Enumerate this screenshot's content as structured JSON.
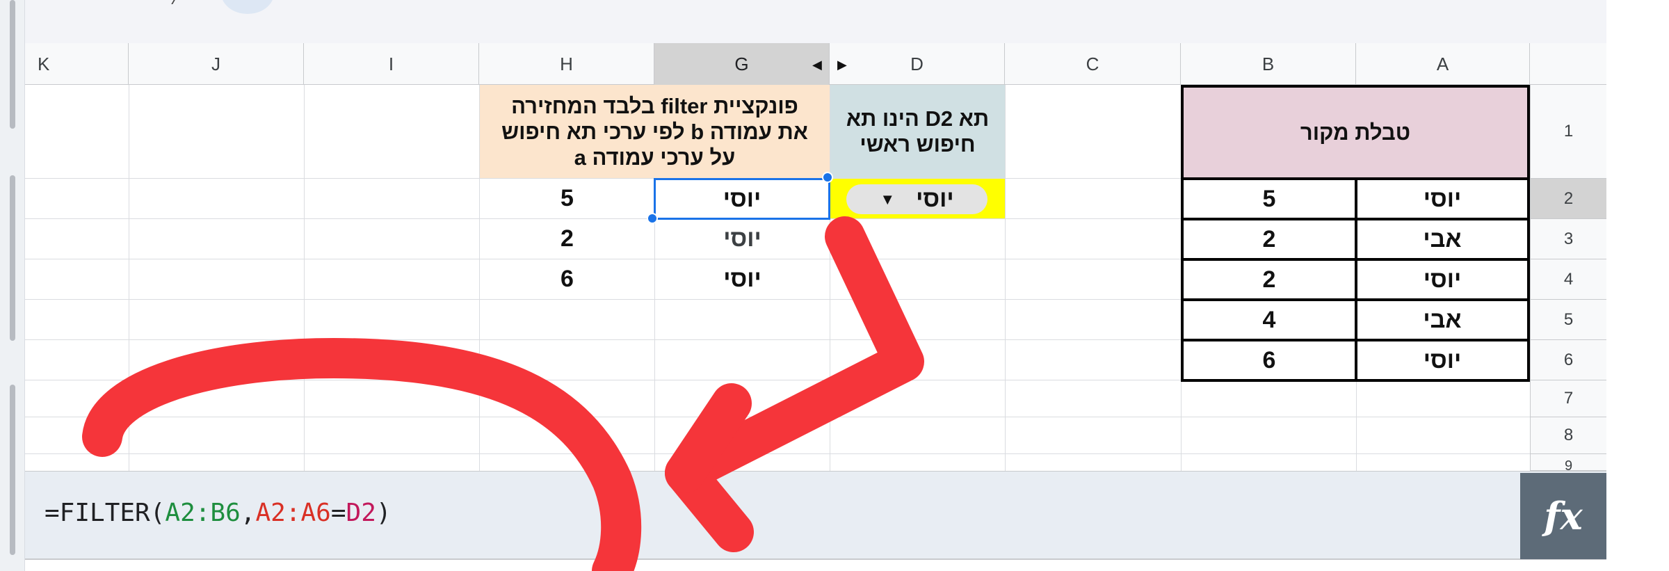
{
  "columns": [
    "K",
    "J",
    "I",
    "H",
    "G",
    "D",
    "C",
    "B",
    "A"
  ],
  "selected_column": "G",
  "rows": [
    "1",
    "2",
    "3",
    "4",
    "5",
    "6",
    "7",
    "8",
    "9"
  ],
  "selected_row": "2",
  "source_table": {
    "title": "טבלת מקור",
    "rows": [
      {
        "a": "יוסי",
        "b": "5"
      },
      {
        "a": "אבי",
        "b": "2"
      },
      {
        "a": "יוסי",
        "b": "2"
      },
      {
        "a": "אבי",
        "b": "4"
      },
      {
        "a": "יוסי",
        "b": "6"
      }
    ]
  },
  "search_cell": {
    "label_line1": "תא D2 הינו תא",
    "label_line2": "חיפוש ראשי",
    "value": "יוסי"
  },
  "filter_result": {
    "label_line1": "פונקציית filter בלבד המחזירה",
    "label_line2": "את עמודה b לפי ערכי תא חיפוש",
    "label_line3": "על ערכי עמודה a",
    "rows": [
      {
        "g": "יוסי",
        "h": "5"
      },
      {
        "g": "יוסי",
        "h": "2"
      },
      {
        "g": "יוסי",
        "h": "6"
      }
    ]
  },
  "formula": {
    "prefix": "=FILTER(",
    "range1": "A2:B6",
    "comma": ",",
    "range2": "A2:A6",
    "equals": "=",
    "cell": "D2",
    "suffix": ")",
    "colors": {
      "range1": "#1e8e3e",
      "range2": "#d93025",
      "cell": "#c2185b"
    }
  },
  "fx_label": "fx",
  "colors": {
    "source_header_bg": "#e8d0da",
    "search_label_bg": "#d0e0e3",
    "filter_label_bg": "#fce5cd",
    "search_cell_bg": "#ffff00",
    "selection_blue": "#1a73e8",
    "annotation_red": "#f5353a"
  }
}
